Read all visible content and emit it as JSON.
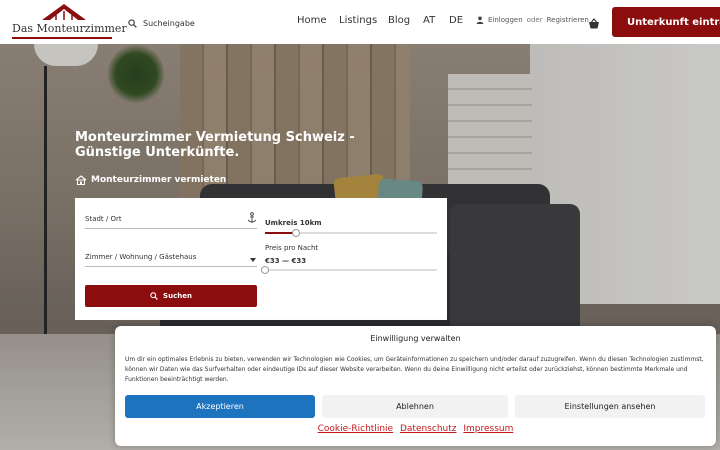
{
  "header": {
    "logo_text": "Das Monteurzimmer",
    "search_placeholder": "Sucheingabe",
    "nav": [
      "Home",
      "Listings",
      "Blog",
      "AT",
      "DE"
    ],
    "login": "Einloggen",
    "login_sep": "oder",
    "register": "Registrieren",
    "cta": "Unterkunft eintragen"
  },
  "hero": {
    "title": "Monteurzimmer Vermietung Schweiz - Günstige Unterkünfte.",
    "subtitle": "Monteurzimmer vermieten"
  },
  "search_form": {
    "city_placeholder": "Stadt / Ort",
    "type_placeholder": "Zimmer / Wohnung / Gästehaus",
    "radius_label": "Umkreis 10km",
    "radius_level": 0.18,
    "price_label": "Preis pro Nacht",
    "price_value": "€33 — €33",
    "submit": "Suchen"
  },
  "consent": {
    "title": "Einwilligung verwalten",
    "text": "Um dir ein optimales Erlebnis zu bieten, verwenden wir Technologien wie Cookies, um Geräteinformationen zu speichern und/oder darauf zuzugreifen. Wenn du diesen Technologien zustimmst, können wir Daten wie das Surfverhalten oder eindeutige IDs auf dieser Website verarbeiten. Wenn du deine Einwilligung nicht erteilst oder zurückziehst, können bestimmte Merkmale und Funktionen beeinträchtigt werden.",
    "accept": "Akzeptieren",
    "deny": "Ablehnen",
    "settings": "Einstellungen ansehen",
    "links": [
      "Cookie-Richtlinie",
      "Datenschutz",
      "Impressum"
    ]
  },
  "colors": {
    "brand": "#8b0d0d",
    "accept_button": "#1e73be",
    "link": "#c4171d"
  }
}
